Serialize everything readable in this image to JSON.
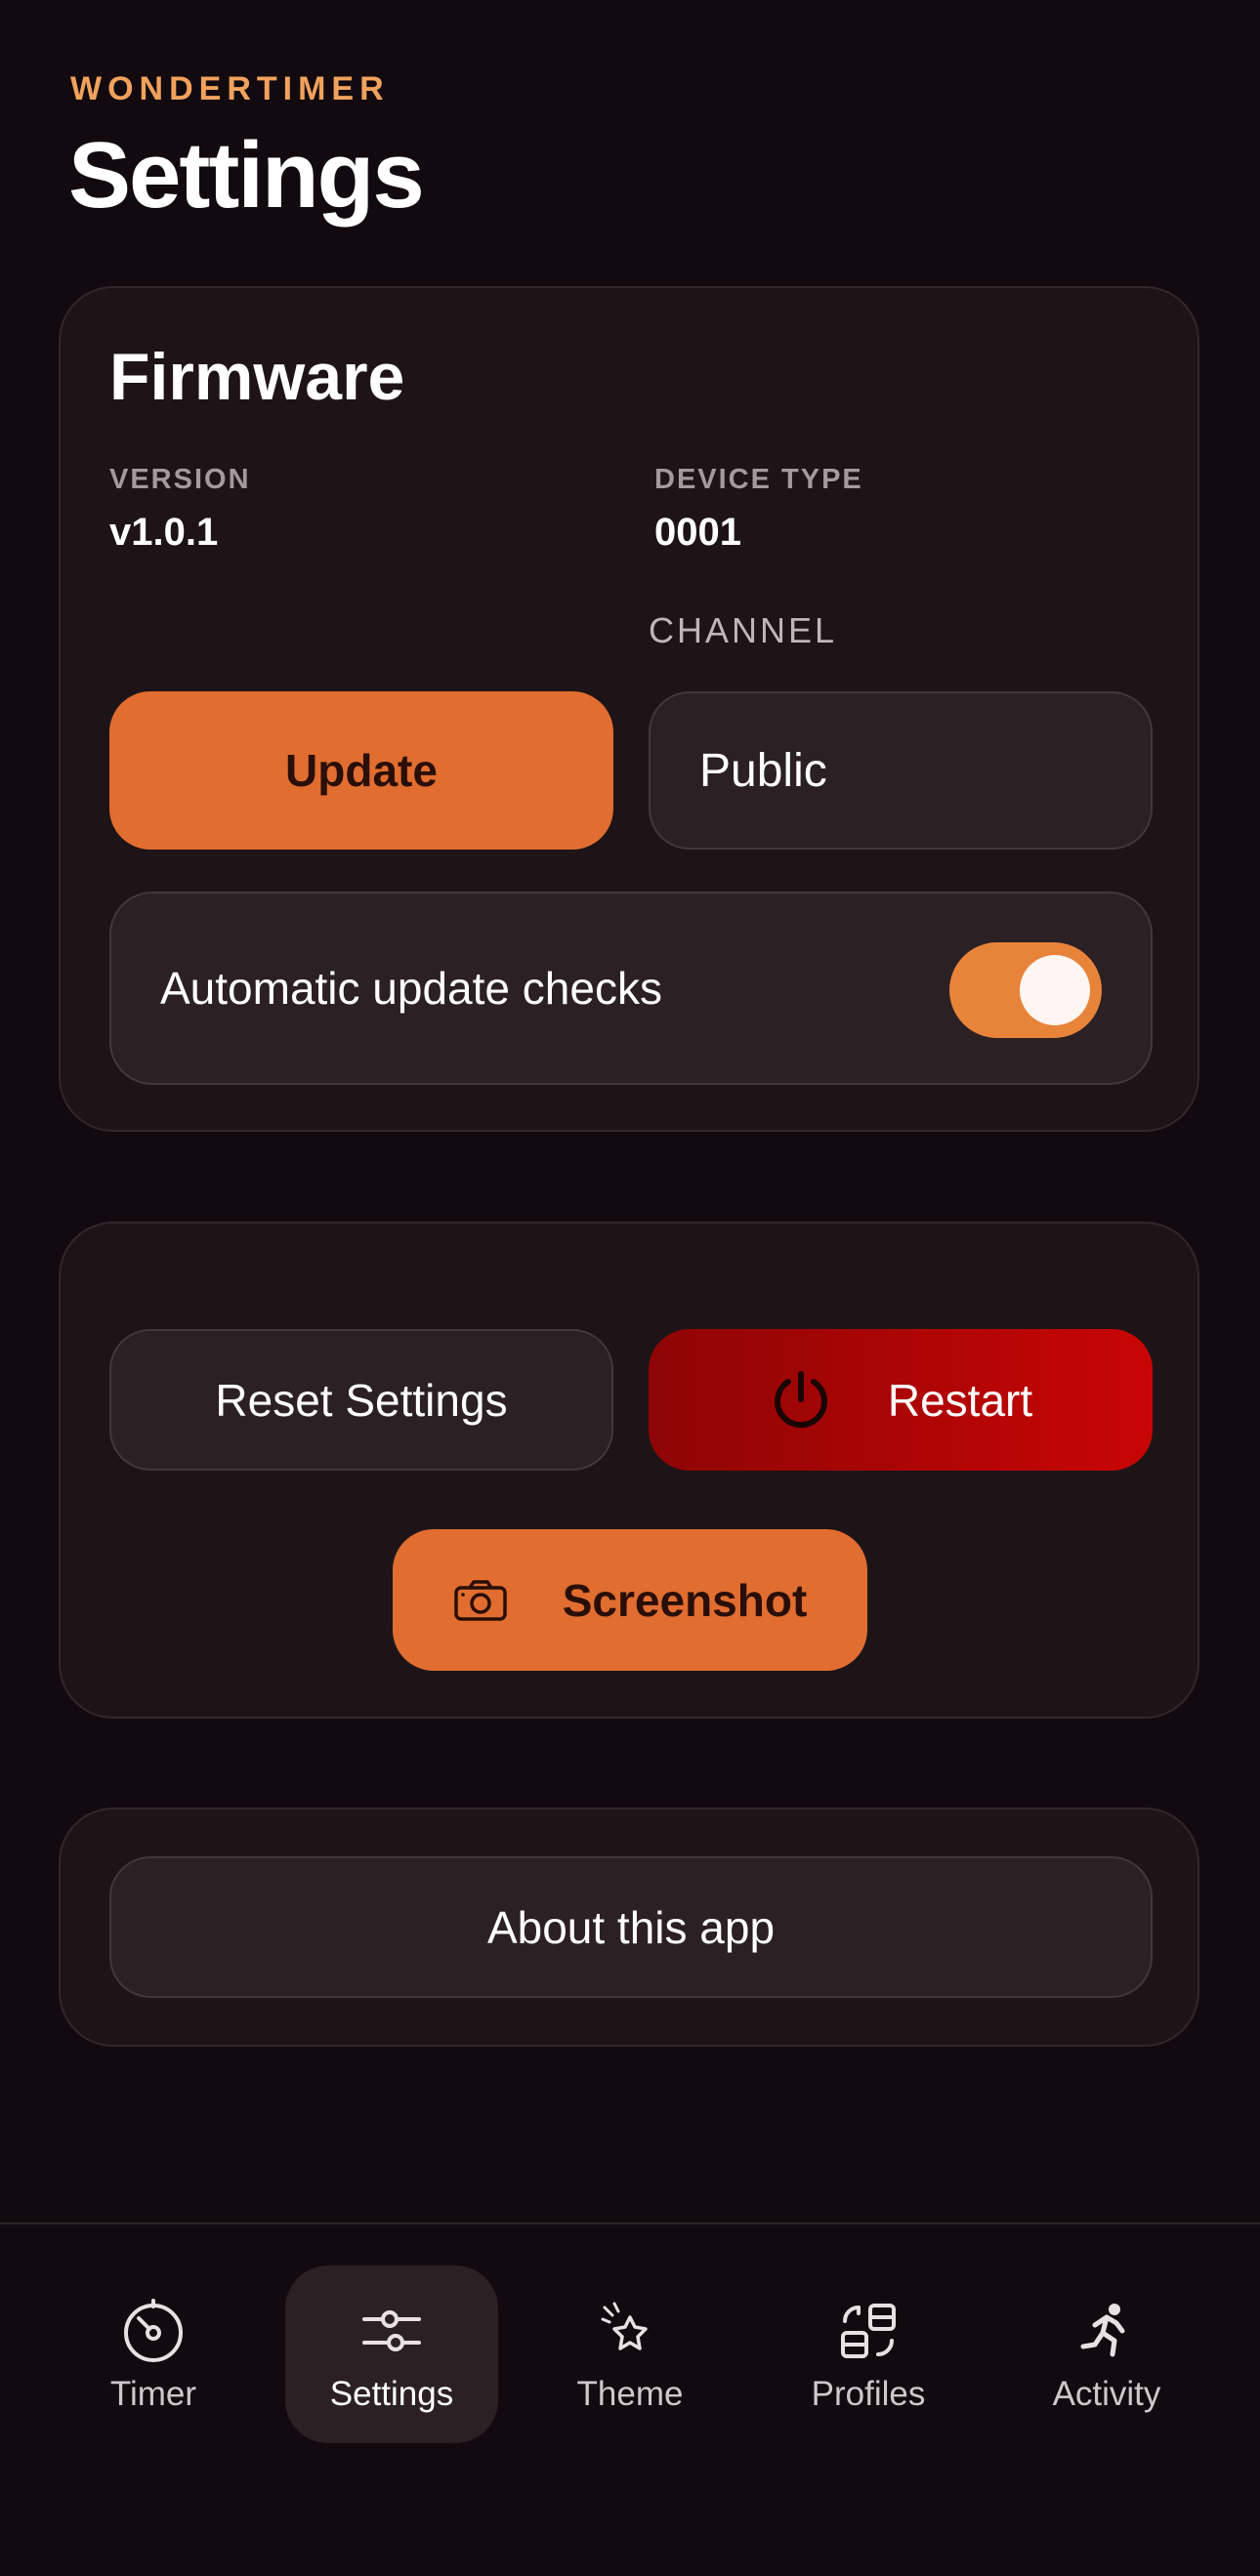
{
  "header": {
    "brand": "WONDERTIMER",
    "title": "Settings"
  },
  "firmware": {
    "title": "Firmware",
    "version_label": "VERSION",
    "version_value": "v1.0.1",
    "device_type_label": "DEVICE TYPE",
    "device_type_value": "0001",
    "channel_label": "CHANNEL",
    "update_label": "Update",
    "channel_value": "Public",
    "auto_update_label": "Automatic update checks",
    "auto_update_enabled": true
  },
  "actions": {
    "reset_label": "Reset Settings",
    "restart_label": "Restart",
    "screenshot_label": "Screenshot"
  },
  "about": {
    "label": "About this app"
  },
  "tabbar": {
    "active": "Settings",
    "items": [
      {
        "label": "Timer",
        "icon": "timer-icon"
      },
      {
        "label": "Settings",
        "icon": "sliders-icon"
      },
      {
        "label": "Theme",
        "icon": "theme-icon"
      },
      {
        "label": "Profiles",
        "icon": "profiles-icon"
      },
      {
        "label": "Activity",
        "icon": "running-icon"
      }
    ]
  },
  "colors": {
    "background": "#120a0f",
    "accent": "#e16d30",
    "brand": "#f0a25c",
    "danger": "#c90505",
    "card": "#1e1417"
  }
}
